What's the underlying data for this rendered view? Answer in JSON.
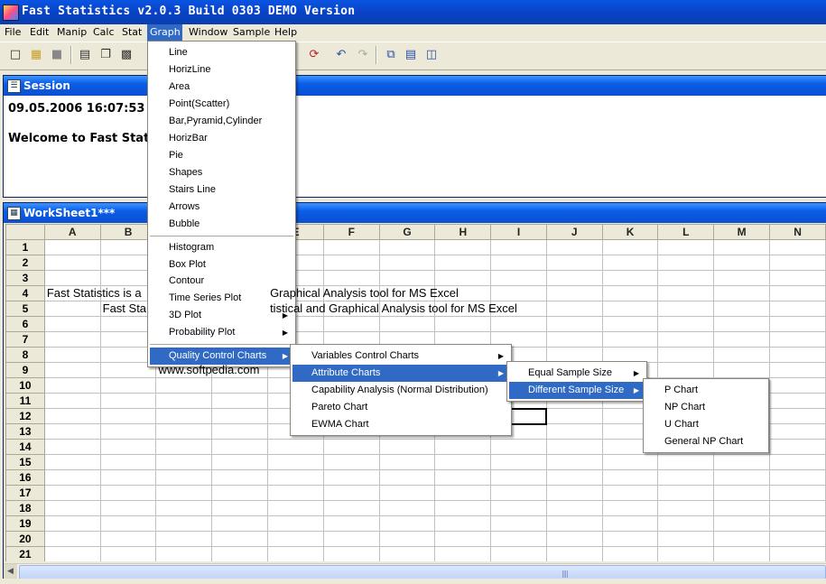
{
  "app": {
    "title": "Fast Statistics v2.0.3 Build 0303 DEMO Version"
  },
  "menubar": [
    "File",
    "Edit",
    "Manip",
    "Calc",
    "Stat",
    "Graph",
    "Window",
    "Sample",
    "Help"
  ],
  "session": {
    "title": "Session",
    "timestamp": "09.05.2006 16:07:53",
    "welcome": "Welcome to Fast Stati"
  },
  "worksheet": {
    "title": "WorkSheet1***",
    "columns": [
      "A",
      "B",
      "C",
      "D",
      "E",
      "F",
      "G",
      "H",
      "I",
      "J",
      "K",
      "L",
      "M",
      "N"
    ],
    "rows": [
      "1",
      "2",
      "3",
      "4",
      "5",
      "6",
      "7",
      "8",
      "9",
      "10",
      "11",
      "12",
      "13",
      "14",
      "15",
      "16",
      "17",
      "18",
      "19",
      "20",
      "21"
    ],
    "cells": {
      "A4": "Fast Statistics is a",
      "E4": "Graphical Analysis tool for MS Excel",
      "B5": "Fast Sta",
      "E5": "tistical and Graphical Analysis tool for MS Excel",
      "C9": "www.softpedia.com"
    }
  },
  "graph_menu": {
    "group1": [
      "Line",
      "HorizLine",
      "Area",
      "Point(Scatter)",
      "Bar,Pyramid,Cylinder",
      "HorizBar",
      "Pie",
      "Shapes",
      "Stairs Line",
      "Arrows",
      "Bubble"
    ],
    "group2": [
      "Histogram",
      "Box Plot",
      "Contour",
      "Time Series Plot",
      "3D Plot",
      "Probability Plot"
    ],
    "group3": [
      "Quality Control  Charts"
    ]
  },
  "qc_menu": [
    "Variables Control Charts",
    "Attribute Charts",
    "Capability Analysis (Normal Distribution)",
    "Pareto Chart",
    "EWMA Chart"
  ],
  "attribute_menu": [
    "Equal Sample Size",
    "Different Sample Size"
  ],
  "different_size_menu": [
    "P Chart",
    "NP Chart",
    "U Chart",
    "General NP Chart"
  ],
  "colors": {
    "highlight": "#316ac5",
    "titlebar": "#0a55e3"
  }
}
